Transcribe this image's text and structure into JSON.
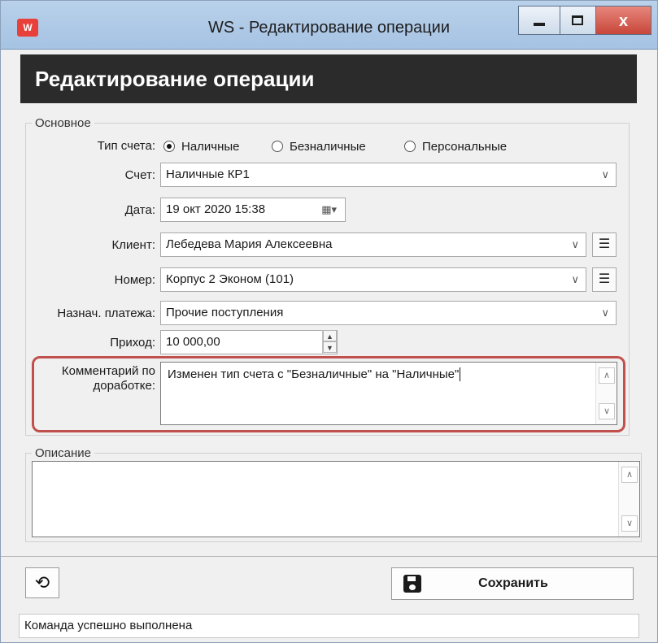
{
  "window": {
    "title": "WS - Редактирование операции",
    "icon_label": "W",
    "minimize_icon": "minimize-icon",
    "maximize_icon": "maximize-icon",
    "close_label": "x"
  },
  "header": {
    "title": "Редактирование операции"
  },
  "main_group": {
    "title": "Основное",
    "account_type": {
      "label": "Тип счета:",
      "options": [
        "Наличные",
        "Безналичные",
        "Персональные"
      ],
      "selected": "Наличные"
    },
    "account": {
      "label": "Счет:",
      "value": "Наличные КР1"
    },
    "date": {
      "label": "Дата:",
      "value": "19 окт  2020  15:38"
    },
    "client": {
      "label": "Клиент:",
      "value": "Лебедева Мария Алексеевна"
    },
    "room": {
      "label": "Номер:",
      "value": "Корпус 2 Эконом (101)"
    },
    "purpose": {
      "label": "Назнач. платежа:",
      "value": "Прочие поступления"
    },
    "income": {
      "label": "Приход:",
      "value": "10 000,00"
    },
    "comment": {
      "label_line1": "Комментарий по",
      "label_line2": "доработке:",
      "value": "Изменен тип счета с \"Безналичные\" на \"Наличные\""
    }
  },
  "description_group": {
    "title": "Описание",
    "value": ""
  },
  "footer": {
    "save_label": "Сохранить",
    "status_text": "Команда успешно выполнена"
  },
  "colors": {
    "header_bg": "#2b2b2b",
    "highlight": "#c0504d",
    "titlebar": "#b9d1ea"
  }
}
